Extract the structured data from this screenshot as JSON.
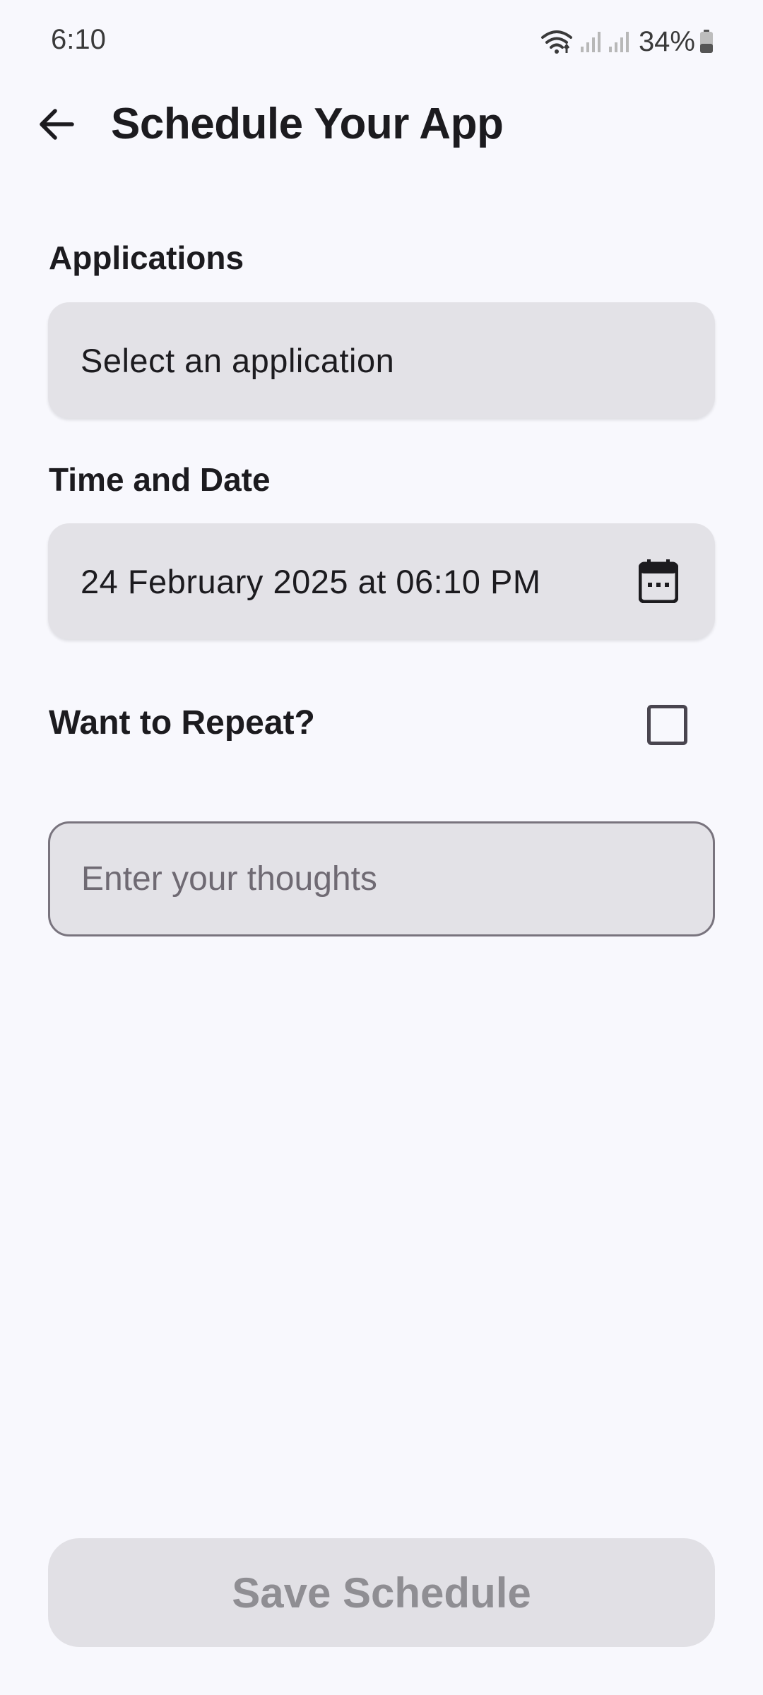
{
  "status_bar": {
    "time": "6:10",
    "battery": "34%",
    "icons": [
      "wifi-icon",
      "signal-icon",
      "signal-icon",
      "battery-icon"
    ]
  },
  "app_bar": {
    "back_icon": "arrow-left-icon",
    "title": "Schedule Your App"
  },
  "form": {
    "applications": {
      "label": "Applications",
      "value": "Select an application"
    },
    "time_and_date": {
      "label": "Time and Date",
      "value": "24 February 2025 at 06:10 PM",
      "icon": "calendar-icon"
    },
    "repeat": {
      "label": "Want to Repeat?",
      "checked": false
    },
    "thoughts": {
      "value": "",
      "placeholder": "Enter your thoughts"
    },
    "save_label": "Save Schedule"
  },
  "colors": {
    "background": "#f8f8fd",
    "field": "#e3e2e7",
    "text": "#1c1b1f",
    "disabled_text": "#8f8e93",
    "disabled_button": "#e1e0e5"
  }
}
